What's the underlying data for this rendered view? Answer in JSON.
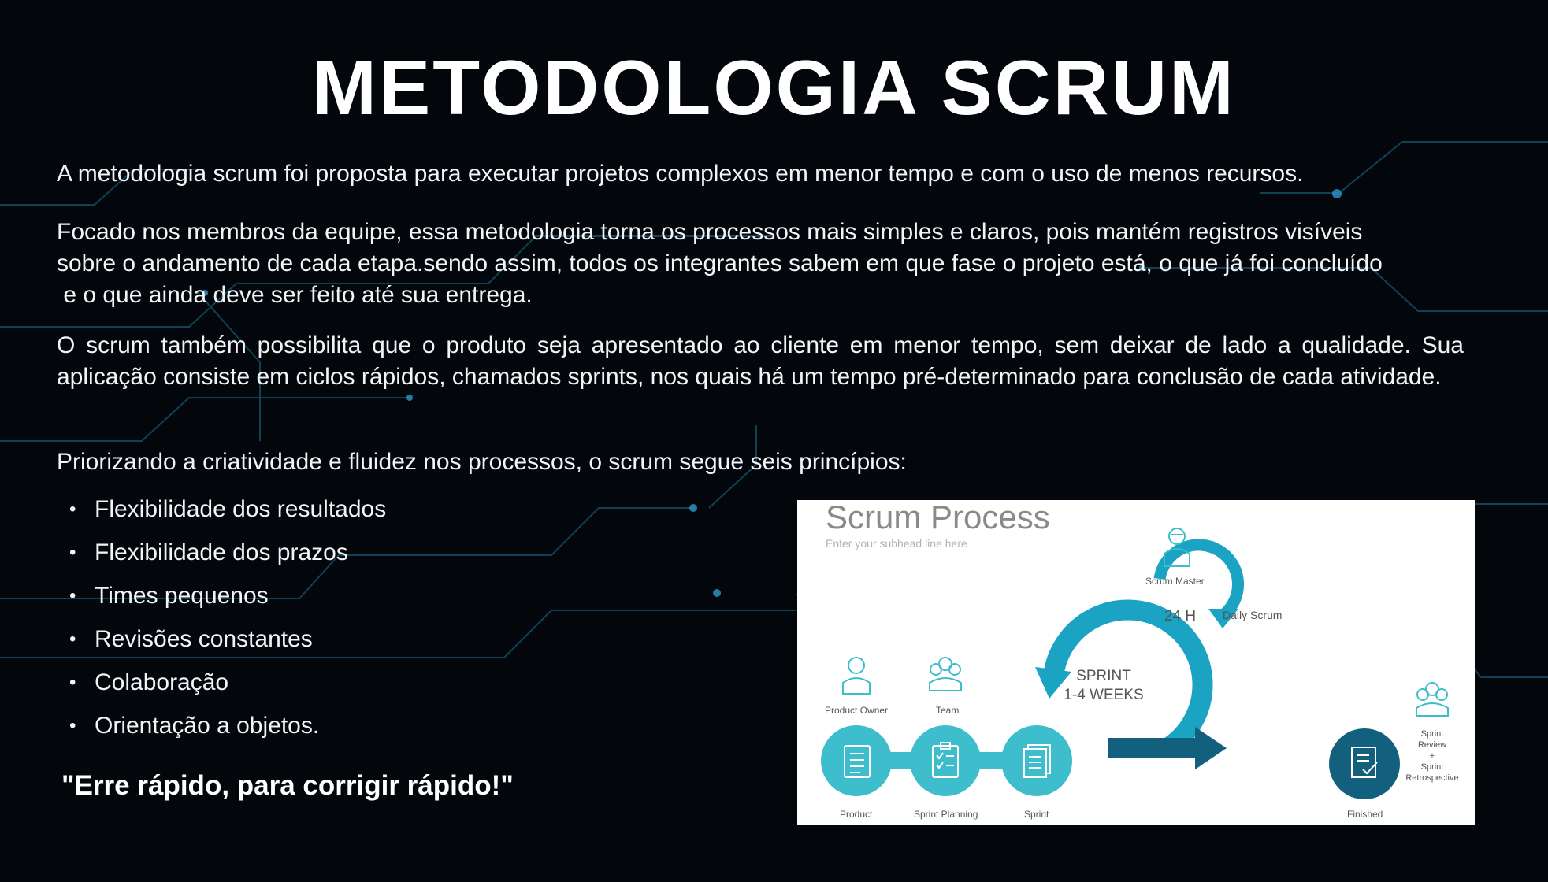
{
  "slide": {
    "title": "METODOLOGIA SCRUM",
    "paragraphs": {
      "p1": "A metodologia scrum foi proposta para executar projetos complexos em menor tempo e com o uso de menos recursos.",
      "p2_line1": "Focado nos membros da equipe, essa metodologia torna os processos mais simples e claros, pois mantém registros  visíveis",
      "p2_line2": "sobre o andamento de cada etapa.sendo assim, todos os integrantes sabem em que fase o projeto está, o que já foi concluído",
      "p2_line3": " e o que ainda deve ser feito até sua entrega.",
      "p3": "O scrum também possibilita que o produto seja apresentado ao cliente em menor tempo, sem deixar de lado a qualidade. Sua aplicação consiste em ciclos rápidos, chamados sprints, nos quais há um tempo pré-determinado para conclusão de cada atividade.",
      "p4": "Priorizando a criatividade e fluidez nos processos, o scrum segue seis princípios:"
    },
    "bullet_glyph": "•",
    "principles": [
      "Flexibilidade dos resultados",
      "Flexibilidade dos prazos",
      "Times pequenos",
      "Revisões constantes",
      "Colaboração",
      "Orientação a objetos."
    ],
    "quote": "\"Erre rápido, para corrigir rápido!\""
  },
  "scrum_image": {
    "title": "Scrum Process",
    "subtitle": "Enter your subhead line here",
    "labels": {
      "scrum_master": "Scrum Master",
      "daily_scrum": "Daily Scrum",
      "hours": "24 H",
      "sprint_line1": "SPRINT",
      "sprint_line2": "1-4 WEEKS",
      "product_owner": "Product Owner",
      "team": "Team",
      "sprint_review_1": "Sprint",
      "sprint_review_2": "Review",
      "sprint_review_3": "+",
      "sprint_review_4": "Sprint",
      "sprint_review_5": "Retrospective",
      "product_backlog": "Product",
      "sprint_planning": "Sprint Planning",
      "sprint_backlog": "Sprint",
      "finished_work": "Finished"
    },
    "icons": [
      "scrum-master-icon",
      "product-owner-icon",
      "team-icon",
      "stakeholders-icon",
      "product-backlog-icon",
      "sprint-planning-icon",
      "sprint-backlog-icon",
      "finished-work-icon"
    ],
    "colors": {
      "teal_light": "#3ebdcc",
      "teal": "#1aa3c2",
      "navy": "#13607e"
    }
  },
  "theme": {
    "background": "#03070c",
    "circuit": "#1d6f96",
    "text": "#ffffff"
  }
}
